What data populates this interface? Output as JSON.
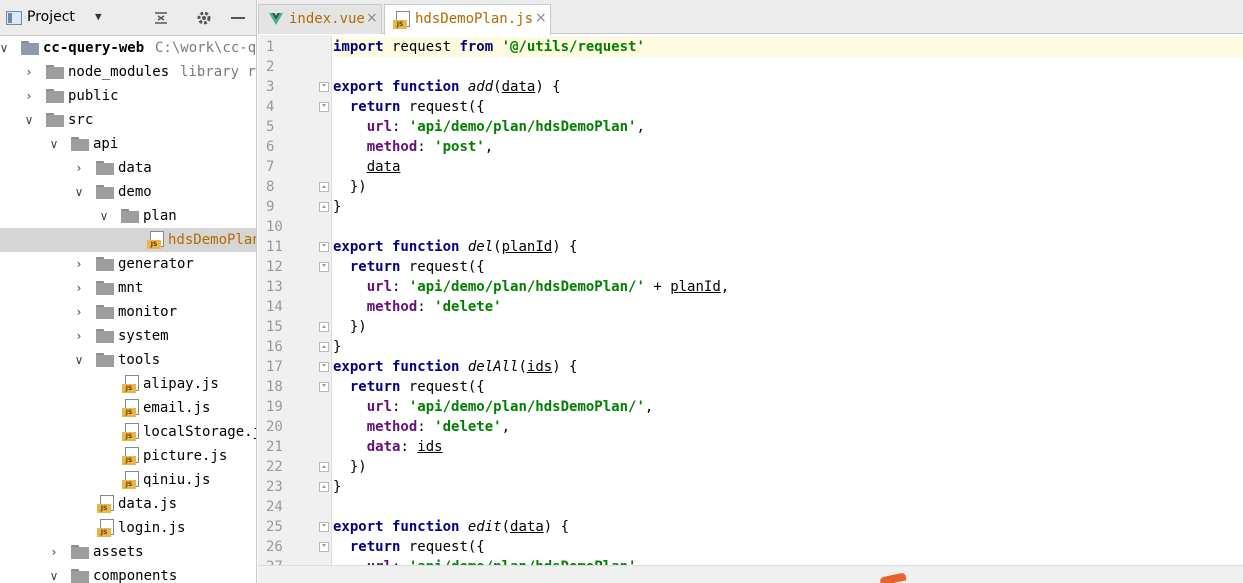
{
  "project_panel": {
    "title": "Project",
    "dropdown": "▼",
    "tree": [
      {
        "label": "cc-query-web",
        "hint": "C:\\work\\cc-q",
        "arrow": "∨",
        "level": 0,
        "type": "module",
        "bold": true
      },
      {
        "label": "node_modules",
        "hint": "library ro",
        "arrow": "›",
        "level": 1,
        "type": "folder"
      },
      {
        "label": "public",
        "hint": "",
        "arrow": "›",
        "level": 1,
        "type": "folder"
      },
      {
        "label": "src",
        "hint": "",
        "arrow": "∨",
        "level": 1,
        "type": "folder"
      },
      {
        "label": "api",
        "hint": "",
        "arrow": "∨",
        "level": 2,
        "type": "folder"
      },
      {
        "label": "data",
        "hint": "",
        "arrow": "›",
        "level": 3,
        "type": "folder"
      },
      {
        "label": "demo",
        "hint": "",
        "arrow": "∨",
        "level": 3,
        "type": "folder"
      },
      {
        "label": "plan",
        "hint": "",
        "arrow": "∨",
        "level": 4,
        "type": "folder"
      },
      {
        "label": "hdsDemoPlan",
        "hint": "",
        "arrow": "",
        "level": 5,
        "type": "js",
        "selected": true,
        "orange": true
      },
      {
        "label": "generator",
        "hint": "",
        "arrow": "›",
        "level": 3,
        "type": "folder"
      },
      {
        "label": "mnt",
        "hint": "",
        "arrow": "›",
        "level": 3,
        "type": "folder"
      },
      {
        "label": "monitor",
        "hint": "",
        "arrow": "›",
        "level": 3,
        "type": "folder"
      },
      {
        "label": "system",
        "hint": "",
        "arrow": "›",
        "level": 3,
        "type": "folder"
      },
      {
        "label": "tools",
        "hint": "",
        "arrow": "∨",
        "level": 3,
        "type": "folder"
      },
      {
        "label": "alipay.js",
        "hint": "",
        "arrow": "",
        "level": 4,
        "type": "js"
      },
      {
        "label": "email.js",
        "hint": "",
        "arrow": "",
        "level": 4,
        "type": "js"
      },
      {
        "label": "localStorage.j",
        "hint": "",
        "arrow": "",
        "level": 4,
        "type": "js"
      },
      {
        "label": "picture.js",
        "hint": "",
        "arrow": "",
        "level": 4,
        "type": "js"
      },
      {
        "label": "qiniu.js",
        "hint": "",
        "arrow": "",
        "level": 4,
        "type": "js"
      },
      {
        "label": "data.js",
        "hint": "",
        "arrow": "",
        "level": 3,
        "type": "js"
      },
      {
        "label": "login.js",
        "hint": "",
        "arrow": "",
        "level": 3,
        "type": "js"
      },
      {
        "label": "assets",
        "hint": "",
        "arrow": "›",
        "level": 2,
        "type": "folder"
      },
      {
        "label": "components",
        "hint": "",
        "arrow": "∨",
        "level": 2,
        "type": "folder"
      }
    ]
  },
  "editor": {
    "tabs": [
      {
        "label": "index.vue",
        "icon": "vue-icon",
        "active": false,
        "close": "×"
      },
      {
        "label": "hdsDemoPlan.js",
        "icon": "js-icon",
        "active": true,
        "close": "×"
      }
    ],
    "js_badge": "JS",
    "line_numbers": [
      "1",
      "2",
      "3",
      "4",
      "5",
      "6",
      "7",
      "8",
      "9",
      "10",
      "11",
      "12",
      "13",
      "14",
      "15",
      "16",
      "17",
      "18",
      "19",
      "20",
      "21",
      "22",
      "23",
      "24",
      "25",
      "26",
      "27"
    ],
    "fold_markers": {
      "open": [
        3,
        4,
        11,
        12,
        17,
        18,
        25,
        26
      ],
      "close": [
        8,
        9,
        15,
        16,
        22,
        23
      ]
    },
    "lines": [
      [
        [
          "kw",
          "import"
        ],
        [
          "t",
          " request "
        ],
        [
          "kw",
          "from"
        ],
        [
          "t",
          " "
        ],
        [
          "str",
          "'@/utils/request'"
        ]
      ],
      [],
      [
        [
          "kw",
          "export function"
        ],
        [
          "t",
          " "
        ],
        [
          "fn",
          "add"
        ],
        [
          "t",
          "("
        ],
        [
          "ul",
          "data"
        ],
        [
          "t",
          ") {"
        ]
      ],
      [
        [
          "t",
          "  "
        ],
        [
          "kw",
          "return"
        ],
        [
          "t",
          " request({"
        ]
      ],
      [
        [
          "t",
          "    "
        ],
        [
          "prop",
          "url"
        ],
        [
          "t",
          ": "
        ],
        [
          "str",
          "'api/demo/plan/hdsDemoPlan'"
        ],
        [
          "t",
          ","
        ]
      ],
      [
        [
          "t",
          "    "
        ],
        [
          "prop",
          "method"
        ],
        [
          "t",
          ": "
        ],
        [
          "str",
          "'post'"
        ],
        [
          "t",
          ","
        ]
      ],
      [
        [
          "t",
          "    "
        ],
        [
          "ul",
          "data"
        ]
      ],
      [
        [
          "t",
          "  })"
        ]
      ],
      [
        [
          "t",
          "}"
        ]
      ],
      [],
      [
        [
          "kw",
          "export function"
        ],
        [
          "t",
          " "
        ],
        [
          "fn",
          "del"
        ],
        [
          "t",
          "("
        ],
        [
          "ul",
          "planId"
        ],
        [
          "t",
          ") {"
        ]
      ],
      [
        [
          "t",
          "  "
        ],
        [
          "kw",
          "return"
        ],
        [
          "t",
          " request({"
        ]
      ],
      [
        [
          "t",
          "    "
        ],
        [
          "prop",
          "url"
        ],
        [
          "t",
          ": "
        ],
        [
          "str",
          "'api/demo/plan/hdsDemoPlan/'"
        ],
        [
          "t",
          " + "
        ],
        [
          "ul",
          "planId"
        ],
        [
          "t",
          ","
        ]
      ],
      [
        [
          "t",
          "    "
        ],
        [
          "prop",
          "method"
        ],
        [
          "t",
          ": "
        ],
        [
          "str",
          "'delete'"
        ]
      ],
      [
        [
          "t",
          "  })"
        ]
      ],
      [
        [
          "t",
          "}"
        ]
      ],
      [
        [
          "kw",
          "export function"
        ],
        [
          "t",
          " "
        ],
        [
          "fn",
          "delAll"
        ],
        [
          "t",
          "("
        ],
        [
          "ul",
          "ids"
        ],
        [
          "t",
          ") {"
        ]
      ],
      [
        [
          "t",
          "  "
        ],
        [
          "kw",
          "return"
        ],
        [
          "t",
          " request({"
        ]
      ],
      [
        [
          "t",
          "    "
        ],
        [
          "prop",
          "url"
        ],
        [
          "t",
          ": "
        ],
        [
          "str",
          "'api/demo/plan/hdsDemoPlan/'"
        ],
        [
          "t",
          ","
        ]
      ],
      [
        [
          "t",
          "    "
        ],
        [
          "prop",
          "method"
        ],
        [
          "t",
          ": "
        ],
        [
          "str",
          "'delete'"
        ],
        [
          "t",
          ","
        ]
      ],
      [
        [
          "t",
          "    "
        ],
        [
          "prop",
          "data"
        ],
        [
          "t",
          ": "
        ],
        [
          "ul",
          "ids"
        ]
      ],
      [
        [
          "t",
          "  })"
        ]
      ],
      [
        [
          "t",
          "}"
        ]
      ],
      [],
      [
        [
          "kw",
          "export function"
        ],
        [
          "t",
          " "
        ],
        [
          "fn",
          "edit"
        ],
        [
          "t",
          "("
        ],
        [
          "ul",
          "data"
        ],
        [
          "t",
          ") {"
        ]
      ],
      [
        [
          "t",
          "  "
        ],
        [
          "kw",
          "return"
        ],
        [
          "t",
          " request({"
        ]
      ],
      [
        [
          "t",
          "    "
        ],
        [
          "prop",
          "url"
        ],
        [
          "t",
          ": "
        ],
        [
          "str",
          "'api/demo/plan/hdsDemoPlan'"
        ],
        [
          "t",
          ","
        ]
      ]
    ]
  }
}
